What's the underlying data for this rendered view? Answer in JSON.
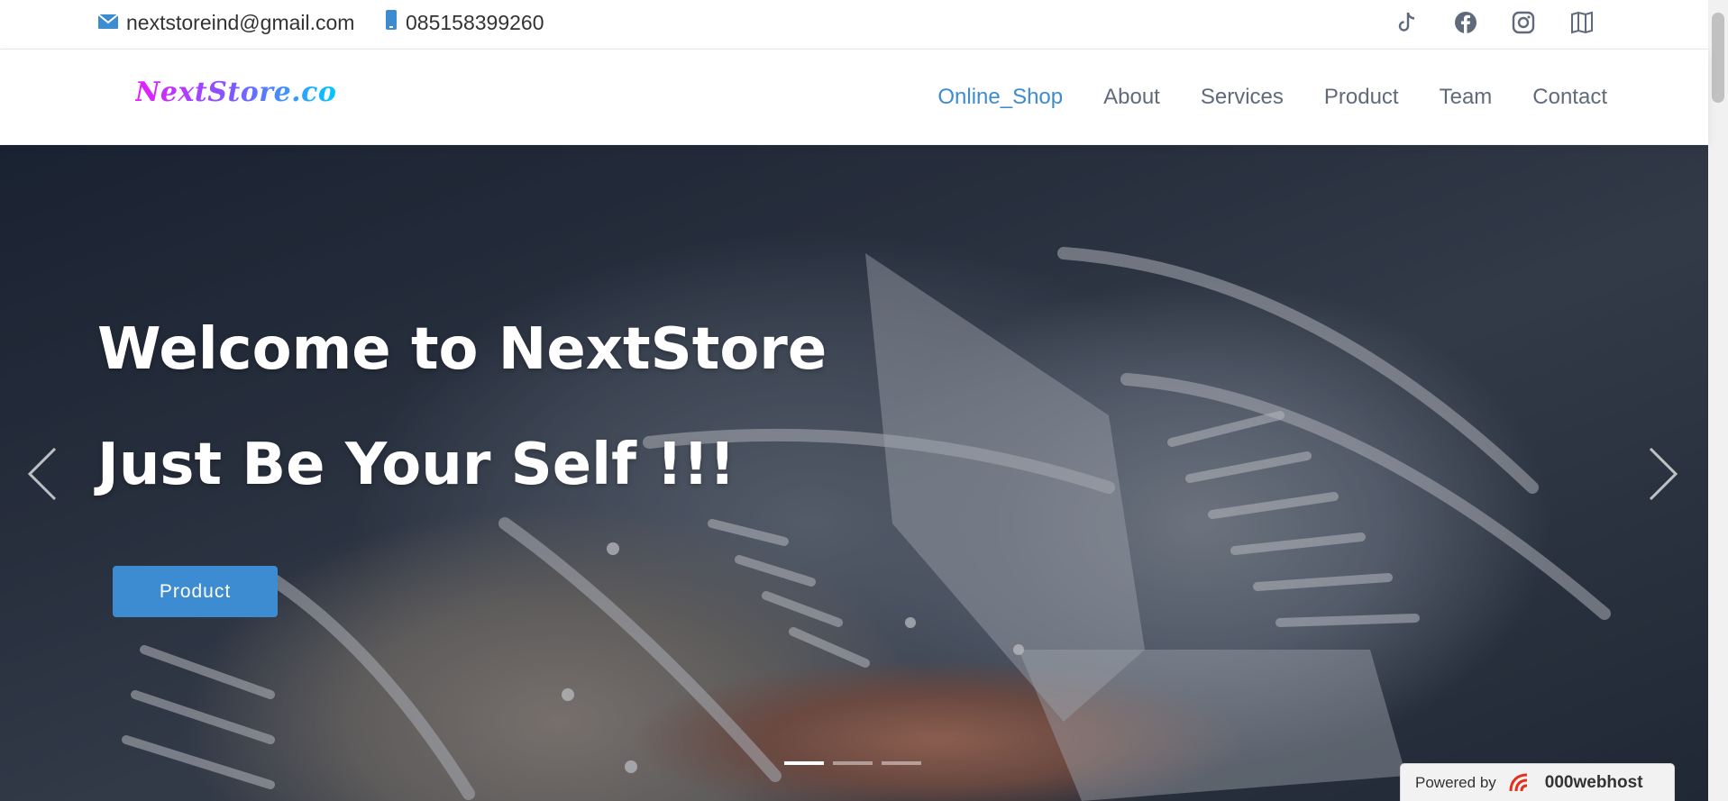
{
  "topbar": {
    "email": "nextstoreind@gmail.com",
    "phone": "085158399260",
    "social_icons": [
      "tiktok-icon",
      "facebook-icon",
      "instagram-icon",
      "map-icon"
    ]
  },
  "header": {
    "logo": "NextStore.co",
    "nav": [
      {
        "label": "Online_Shop",
        "active": true
      },
      {
        "label": "About",
        "active": false
      },
      {
        "label": "Services",
        "active": false
      },
      {
        "label": "Product",
        "active": false
      },
      {
        "label": "Team",
        "active": false
      },
      {
        "label": "Contact",
        "active": false
      }
    ]
  },
  "hero": {
    "title_line1": "Welcome to NextStore",
    "title_line2": "Just Be Your Self !!!",
    "cta_label": "Product",
    "slides": 3,
    "active_slide": 1
  },
  "badge": {
    "powered_by": "Powered by",
    "host": "000webhost"
  },
  "colors": {
    "accent": "#3d8bd1",
    "nav_text": "#5f6b7a",
    "logo_gradient": [
      "#e81cff",
      "#7a5cff",
      "#00c8ff"
    ]
  }
}
